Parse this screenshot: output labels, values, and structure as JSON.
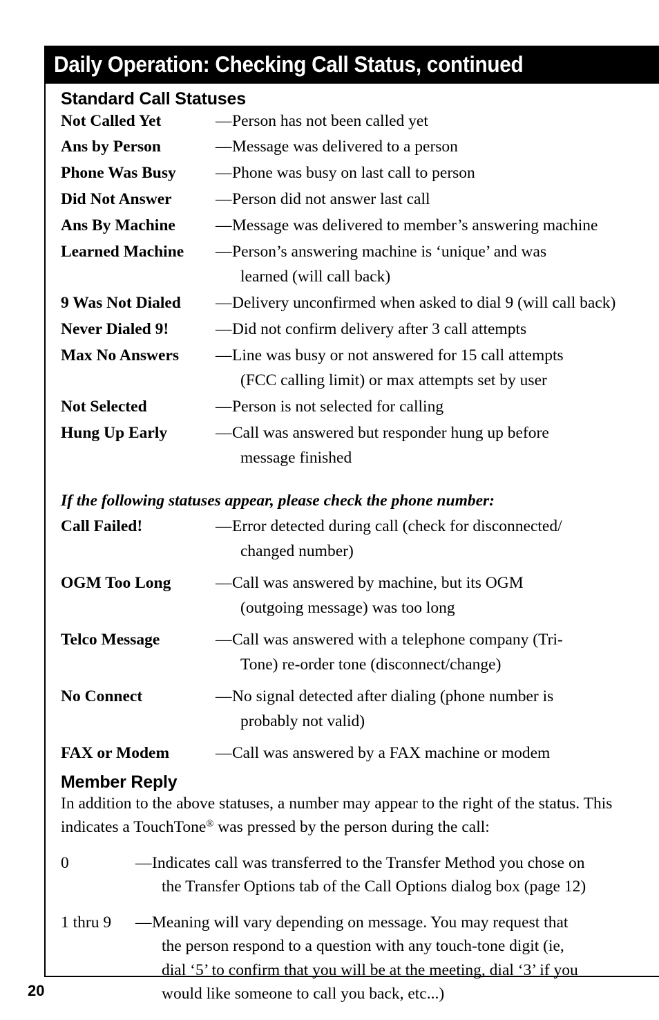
{
  "header": {
    "title": "Daily Operation: Checking Call Status, continued"
  },
  "sections": {
    "standard": {
      "heading": "Standard Call Statuses",
      "dash": "—",
      "items": [
        {
          "term": "Not Called Yet",
          "desc": "Person has not been called yet",
          "cont": ""
        },
        {
          "term": "Ans by Person",
          "desc": "Message was delivered to a person",
          "cont": ""
        },
        {
          "term": "Phone Was Busy",
          "desc": "Phone was busy on last call to person",
          "cont": ""
        },
        {
          "term": "Did Not Answer",
          "desc": "Person did not answer last call",
          "cont": ""
        },
        {
          "term": "Ans By Machine",
          "desc": "Message was delivered to member’s answering machine",
          "cont": ""
        },
        {
          "term": "Learned Machine",
          "desc": "Person’s answering machine is ‘unique’ and was",
          "cont": "learned (will call back)"
        },
        {
          "term": "9 Was Not Dialed",
          "desc": "Delivery unconfirmed when asked to dial 9 (will call back)",
          "cont": ""
        },
        {
          "term": "Never Dialed 9!",
          "desc": "Did not confirm delivery after 3 call attempts",
          "cont": ""
        },
        {
          "term": "Max No Answers",
          "desc": "Line was busy or not answered for 15 call attempts",
          "cont": "(FCC calling limit) or max attempts set by user"
        },
        {
          "term": "Not Selected",
          "desc": "Person is not selected for calling",
          "cont": ""
        },
        {
          "term": "Hung Up Early",
          "desc": "Call was answered but responder hung up before",
          "cont": "message finished"
        }
      ]
    },
    "check_number": {
      "subheading": "If the following statuses appear, please check the phone number:",
      "dash": "—",
      "items": [
        {
          "term": "Call Failed!",
          "desc": "Error detected during call (check for disconnected/",
          "cont": "changed number)"
        },
        {
          "term": "OGM Too Long",
          "desc": "Call was answered by machine, but its OGM",
          "cont": "(outgoing message) was too long"
        },
        {
          "term": "Telco Message",
          "desc": "Call was answered with a telephone company (Tri-",
          "cont": "Tone) re-order tone (disconnect/change)"
        },
        {
          "term": "No Connect",
          "desc": "No signal detected after dialing (phone number is",
          "cont": "probably not valid)"
        },
        {
          "term": "FAX or Modem",
          "desc": "Call was answered by a FAX machine or modem",
          "cont": ""
        }
      ]
    },
    "member_reply": {
      "heading": "Member Reply",
      "intro_part1": "In addition to the above statuses, a number may appear to the right of the status. This indicates a TouchTone",
      "intro_trademark": "®",
      "intro_part2": " was pressed by the person during the call:",
      "dash": "—",
      "keys": [
        {
          "key": "0",
          "desc": "Indicates call was transferred to the Transfer Method you chose on",
          "cont": "the Transfer Options tab of the Call Options dialog box (page 12)",
          "cont2": "",
          "cont3": ""
        },
        {
          "key": "1 thru 9",
          "desc": "Meaning will vary depending on message. You may request that",
          "cont": "the person respond to a question with any touch-tone digit (ie,",
          "cont2": "dial ‘5’ to confirm that you will be at the meeting, dial ‘3’ if you",
          "cont3": "would like someone to call you back, etc...)"
        }
      ]
    }
  },
  "footer": {
    "page_number": "20"
  }
}
